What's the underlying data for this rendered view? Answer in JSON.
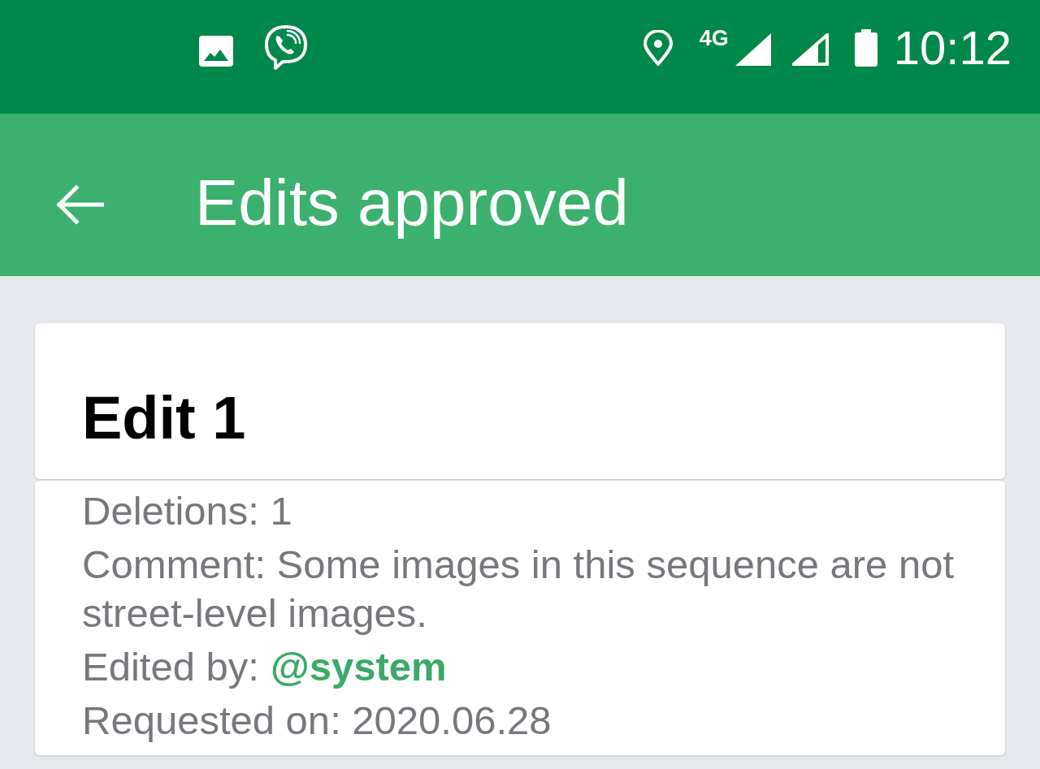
{
  "status_bar": {
    "network": "4G",
    "time": "10:12"
  },
  "app_bar": {
    "title": "Edits approved"
  },
  "edits": [
    {
      "title": "Edit 1",
      "details": [
        {
          "kind": "text",
          "text": "Deletions: 1"
        },
        {
          "kind": "text",
          "text": "Comment: Some images in this sequence are not street-level images."
        },
        {
          "kind": "user",
          "label": "Edited by:",
          "user": "@system"
        },
        {
          "kind": "text",
          "text": "Requested on: 2020.06.28"
        }
      ]
    }
  ]
}
